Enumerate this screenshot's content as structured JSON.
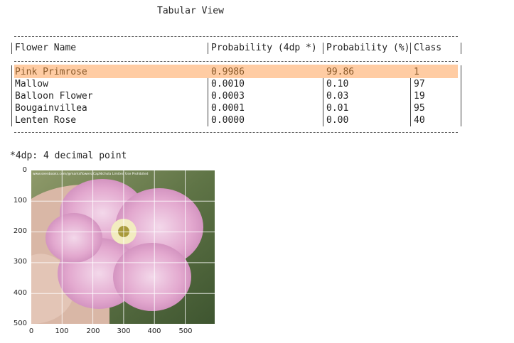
{
  "title": "Tabular View",
  "table": {
    "headers": [
      "Flower Name",
      "Probability (4dp *)",
      "Probability (%)",
      "Class"
    ],
    "rows": [
      {
        "name": "Pink Primrose",
        "prob4": "0.9986",
        "pct": "99.86",
        "cls": "1",
        "highlighted": true
      },
      {
        "name": "Mallow",
        "prob4": "0.0010",
        "pct": "0.10",
        "cls": "97"
      },
      {
        "name": "Balloon Flower",
        "prob4": "0.0003",
        "pct": "0.03",
        "cls": "19"
      },
      {
        "name": "Bougainvillea",
        "prob4": "0.0001",
        "pct": "0.01",
        "cls": "95"
      },
      {
        "name": "Lenten Rose",
        "prob4": "0.0000",
        "pct": "0.00",
        "cls": "40"
      }
    ],
    "highlight_color": "#ffcca3"
  },
  "footnote": "*4dp: 4 decimal point",
  "image_plot": {
    "subject": "pink evening primrose flower held in a hand",
    "watermark": "www.seenbooks.com/@marksflowers/CapNichola Limited Use Prohibited",
    "x_ticks": [
      "0",
      "100",
      "200",
      "300",
      "400",
      "500"
    ],
    "y_ticks": [
      "0",
      "100",
      "200",
      "300",
      "400",
      "500"
    ],
    "grid": true
  }
}
